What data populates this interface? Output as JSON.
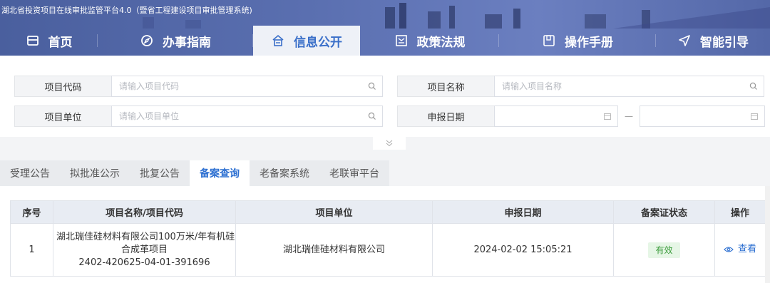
{
  "header": {
    "site_title": "湖北省投资项目在线审批监管平台4.0（暨省工程建设项目审批管理系统)",
    "nav": [
      {
        "label": "首页",
        "icon": "calendar-icon",
        "active": false
      },
      {
        "label": "办事指南",
        "icon": "compass-icon",
        "active": false
      },
      {
        "label": "信息公开",
        "icon": "home-icon",
        "active": true
      },
      {
        "label": "政策法规",
        "icon": "document-icon",
        "active": false
      },
      {
        "label": "操作手册",
        "icon": "book-icon",
        "active": false
      },
      {
        "label": "智能引导",
        "icon": "send-icon",
        "active": false
      }
    ]
  },
  "search": {
    "project_code_label": "项目代码",
    "project_code_placeholder": "请输入项目代码",
    "project_name_label": "项目名称",
    "project_name_placeholder": "请输入项目名称",
    "project_unit_label": "项目单位",
    "project_unit_placeholder": "请输入项目单位",
    "report_date_label": "申报日期",
    "date_separator": "—"
  },
  "tabs": [
    {
      "label": "受理公告",
      "active": false
    },
    {
      "label": "拟批准公示",
      "active": false
    },
    {
      "label": "批复公告",
      "active": false
    },
    {
      "label": "备案查询",
      "active": true
    },
    {
      "label": "老备案系统",
      "active": false
    },
    {
      "label": "老联审平台",
      "active": false
    }
  ],
  "table": {
    "headers": [
      "序号",
      "项目名称/项目代码",
      "项目单位",
      "申报日期",
      "备案证状态",
      "操作"
    ],
    "rows": [
      {
        "index": "1",
        "name_line1": "湖北瑞佳硅材料有限公司100万米/年有机硅",
        "name_line2": "合成革项目",
        "code": "2402-420625-04-01-391696",
        "unit": "湖北瑞佳硅材料有限公司",
        "date": "2024-02-02 15:05:21",
        "status": "有效",
        "action": "查看"
      }
    ]
  },
  "colors": {
    "accent": "#2c6fd1",
    "header_bg": "#5a6fb0",
    "status_green": "#3a9b3a"
  }
}
